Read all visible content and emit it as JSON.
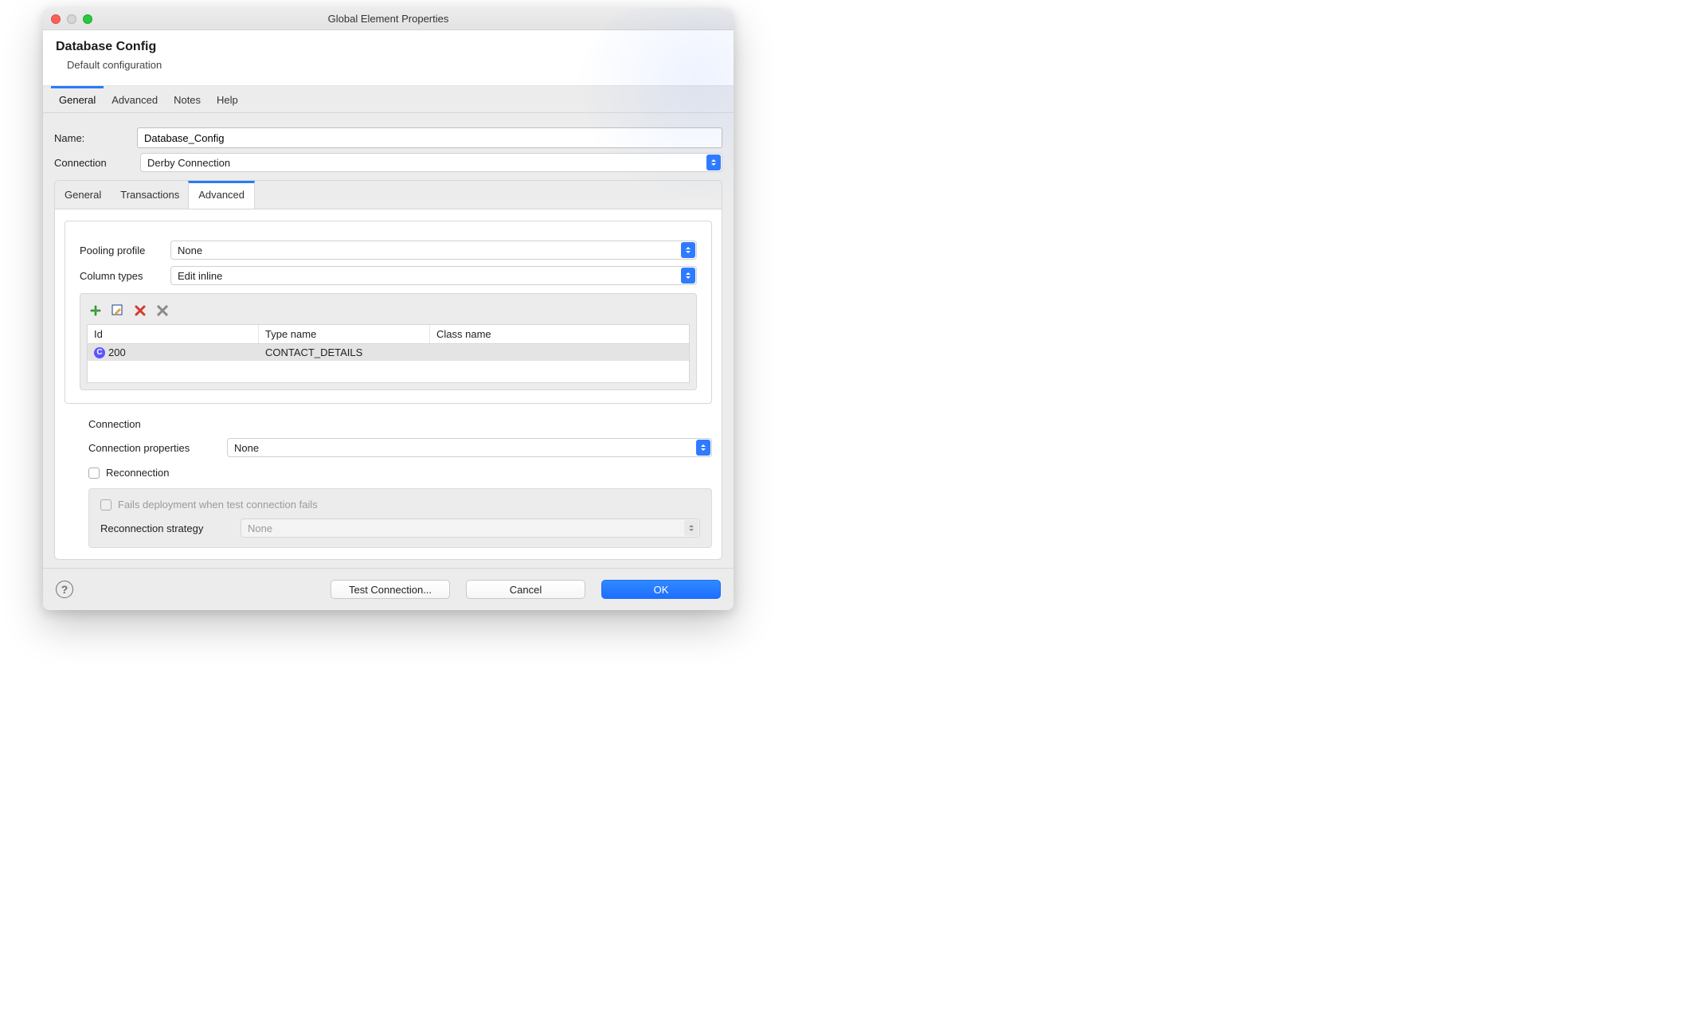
{
  "window_title": "Global Element Properties",
  "header": {
    "title": "Database Config",
    "subtitle": "Default configuration"
  },
  "top_tabs": [
    "General",
    "Advanced",
    "Notes",
    "Help"
  ],
  "top_active": 0,
  "name_label": "Name:",
  "name_value": "Database_Config",
  "connection_label": "Connection",
  "connection_value": "Derby Connection",
  "sub_tabs": [
    "General",
    "Transactions",
    "Advanced"
  ],
  "sub_active": 2,
  "pooling_label": "Pooling profile",
  "pooling_value": "None",
  "coltypes_label": "Column types",
  "coltypes_value": "Edit inline",
  "table": {
    "headers": [
      "Id",
      "Type name",
      "Class name"
    ],
    "rows": [
      {
        "id": "200",
        "type_name": "CONTACT_DETAILS",
        "class_name": ""
      }
    ]
  },
  "conn_section_title": "Connection",
  "conn_props_label": "Connection properties",
  "conn_props_value": "None",
  "reconnection_label": "Reconnection",
  "fails_label": "Fails deployment when test connection fails",
  "recon_strategy_label": "Reconnection strategy",
  "recon_strategy_value": "None",
  "footer": {
    "test": "Test Connection...",
    "cancel": "Cancel",
    "ok": "OK"
  }
}
